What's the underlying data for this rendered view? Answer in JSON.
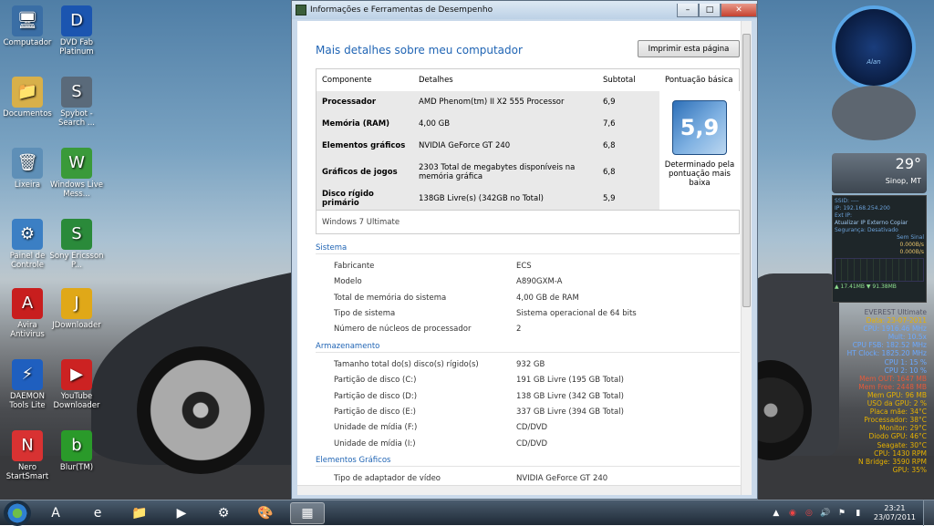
{
  "desktop": {
    "icons": [
      {
        "label": "Computador",
        "glyph": "🖥",
        "color": "#3a6ea5"
      },
      {
        "label": "DVD Fab Platinum",
        "glyph": "D",
        "color": "#1b55b0"
      },
      {
        "label": "Documentos",
        "glyph": "📁",
        "color": "#d8b04a"
      },
      {
        "label": "Spybot - Search ...",
        "glyph": "S",
        "color": "#5a6a7a"
      },
      {
        "label": "Lixeira",
        "glyph": "🗑",
        "color": "#5e8fb7"
      },
      {
        "label": "Windows Live Mess...",
        "glyph": "W",
        "color": "#3a9a3a"
      },
      {
        "label": "Painel de Controle",
        "glyph": "⚙",
        "color": "#3b7fc4"
      },
      {
        "label": "Sony Ericsson P...",
        "glyph": "S",
        "color": "#2a8a3a"
      },
      {
        "label": "Avira Antivirus",
        "glyph": "A",
        "color": "#c81e1e"
      },
      {
        "label": "JDownloader",
        "glyph": "J",
        "color": "#e0a818"
      },
      {
        "label": "DAEMON Tools Lite",
        "glyph": "⚡",
        "color": "#1f5fbf"
      },
      {
        "label": "YouTube Downloader",
        "glyph": "▶",
        "color": "#cc2222"
      },
      {
        "label": "Nero StartSmart",
        "glyph": "N",
        "color": "#d83232"
      },
      {
        "label": "Blur(TM)",
        "glyph": "b",
        "color": "#2a9a2a"
      }
    ]
  },
  "window": {
    "title": "Informações e Ferramentas de Desempenho",
    "minimize": "–",
    "maximize": "□",
    "close": "✕",
    "page_title": "Mais detalhes sobre meu computador",
    "print_button": "Imprimir esta página",
    "table_headers": {
      "component": "Componente",
      "details": "Detalhes",
      "subtotal": "Subtotal",
      "base": "Pontuação básica"
    },
    "rows": [
      {
        "component": "Processador",
        "details": "AMD Phenom(tm) II X2 555 Processor",
        "subtotal": "6,9"
      },
      {
        "component": "Memória (RAM)",
        "details": "4,00 GB",
        "subtotal": "7,6"
      },
      {
        "component": "Elementos gráficos",
        "details": "NVIDIA GeForce GT 240",
        "subtotal": "6,8"
      },
      {
        "component": "Gráficos de jogos",
        "details": "2303 Total de megabytes disponíveis na memória gráfica",
        "subtotal": "6,8"
      },
      {
        "component": "Disco rígido primário",
        "details": "138GB Livre(s) (342GB no Total)",
        "subtotal": "5,9"
      }
    ],
    "base_score": "5,9",
    "base_caption": "Determinado pela pontuação mais baixa",
    "edition": "Windows 7 Ultimate",
    "sections": {
      "system": {
        "title": "Sistema",
        "items": [
          {
            "k": "Fabricante",
            "v": "ECS"
          },
          {
            "k": "Modelo",
            "v": "A890GXM-A"
          },
          {
            "k": "Total de memória do sistema",
            "v": "4,00 GB de RAM"
          },
          {
            "k": "Tipo de sistema",
            "v": "Sistema operacional de 64 bits"
          },
          {
            "k": "Número de núcleos de processador",
            "v": "2"
          }
        ]
      },
      "storage": {
        "title": "Armazenamento",
        "items": [
          {
            "k": "Tamanho total do(s) disco(s) rígido(s)",
            "v": "932 GB"
          },
          {
            "k": "Partição de disco (C:)",
            "v": "191 GB Livre (195 GB Total)"
          },
          {
            "k": "Partição de disco (D:)",
            "v": "138 GB Livre (342 GB Total)"
          },
          {
            "k": "Partição de disco (E:)",
            "v": "337 GB Livre (394 GB Total)"
          },
          {
            "k": "Unidade de mídia (F:)",
            "v": "CD/DVD"
          },
          {
            "k": "Unidade de mídia (I:)",
            "v": "CD/DVD"
          }
        ]
      },
      "graphics": {
        "title": "Elementos Gráficos",
        "items": [
          {
            "k": "Tipo de adaptador de vídeo",
            "v": "NVIDIA GeForce GT 240"
          }
        ]
      }
    }
  },
  "gadgets": {
    "clock_label": "Alan",
    "weather_temp": "29°",
    "weather_city": "Sinop, MT",
    "net": {
      "ssid": "SSID: ----",
      "ip": "IP: 192.168.254.200",
      "ext_ip": "Ext IP:",
      "links": "Atualizar IP Externo   Copiar",
      "security": "Segurança: Desativado",
      "signal": "Sem Sinal",
      "up_rate": "0.000B/s",
      "down_rate": "0.000B/s",
      "totals": "▲ 17.41MB  ▼ 91.38MB"
    },
    "everest": [
      "EVEREST Ultimate",
      "Data: 23-07-2011",
      "CPU: 1916.46 MHz",
      "Mult: 10.5x",
      "CPU FSB: 182.52 MHz",
      "HT Clock: 1825.20 MHz",
      "CPU 1: 15 %",
      "CPU 2: 10 %",
      "Mem OUT: 1647 MB",
      "Mem Free: 2448 MB",
      "Mem GPU: 96 MB",
      "USO da GPU: 2 %",
      "Placa mãe: 34°C",
      "Processador: 38°C",
      "Monitor: 29°C",
      "Diodo GPU: 46°C",
      "Seagate: 30°C",
      "CPU: 1430 RPM",
      "N Bridge: 3590 RPM",
      "GPU: 35%"
    ]
  },
  "taskbar": {
    "items": [
      {
        "name": "avant-browser",
        "glyph": "A"
      },
      {
        "name": "internet-explorer",
        "glyph": "e"
      },
      {
        "name": "windows-explorer",
        "glyph": "📁"
      },
      {
        "name": "media-player",
        "glyph": "▶"
      },
      {
        "name": "control-panel",
        "glyph": "⚙"
      },
      {
        "name": "paint",
        "glyph": "🎨"
      },
      {
        "name": "performance-tool",
        "glyph": "▦"
      }
    ],
    "time": "23:21",
    "date": "23/07/2011"
  }
}
